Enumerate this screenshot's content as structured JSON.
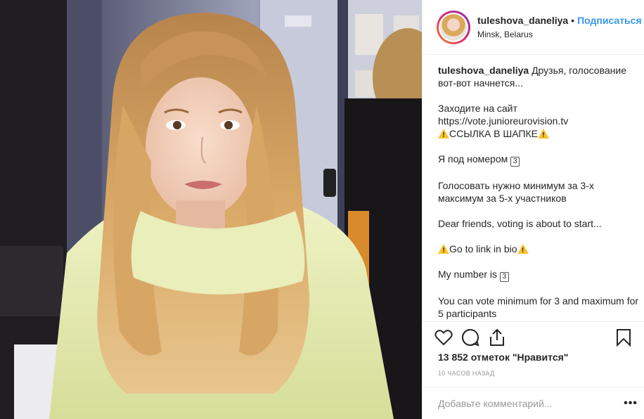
{
  "post": {
    "username": "tuleshova_daneliya",
    "separator": "•",
    "follow_label": "Подписаться",
    "location": "Minsk, Belarus",
    "caption": {
      "line1_text": "Друзья, голосование вот-вот начнется...",
      "line2": "Заходите на сайт",
      "line3": "https://vote.junioreurovision.tv",
      "line4": "ССЫЛКА В ШАПКЕ",
      "line5_text": "Я под номером",
      "line5_number": "3",
      "line6": "Голосовать нужно минимум за 3-х максимум за 5-х участников",
      "line7": "Dear friends, voting is about to start...",
      "line8": "Go to link in bio",
      "line9_text": "My number is",
      "line9_number": "3",
      "line10": "You can vote minimum for 3 and maximum for 5 participants"
    },
    "likes_text": "13 852 отметок \"Нравится\"",
    "time_ago": "10 часов назад",
    "comment_placeholder": "Добавьте комментарий...",
    "more_label": "•••"
  },
  "icons": {
    "like": "heart-icon",
    "comment": "comment-icon",
    "share": "share-icon",
    "save": "bookmark-icon",
    "warning": "warning-icon",
    "more": "more-icon"
  },
  "colors": {
    "link": "#3897f0",
    "warning": "#f7c52c",
    "border": "#efefef",
    "muted": "#999999",
    "hoodie": "#e3eab0"
  }
}
